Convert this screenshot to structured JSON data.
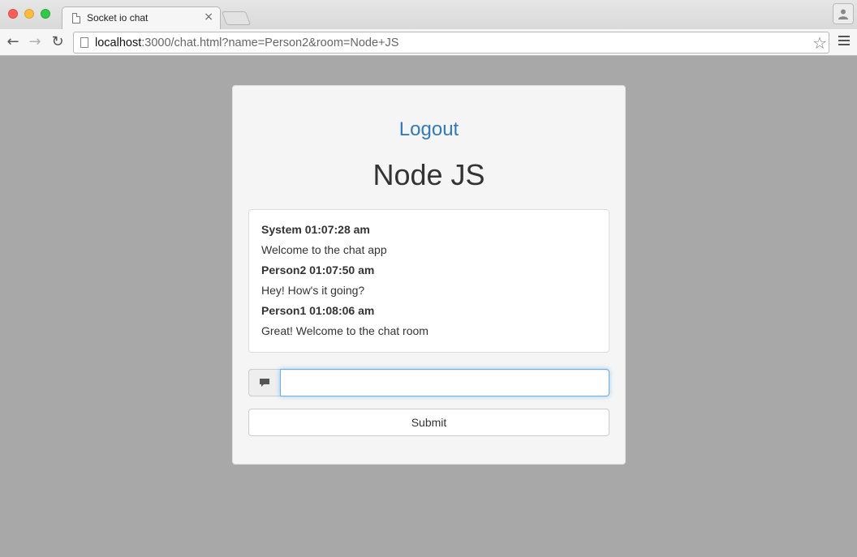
{
  "browser": {
    "tab_title": "Socket io chat",
    "tab_close": "×",
    "url_host": "localhost",
    "url_rest": ":3000/chat.html?name=Person2&room=Node+JS",
    "icons": {
      "back": "back-arrow-icon",
      "forward": "forward-arrow-icon",
      "reload": "reload-icon",
      "bookmark": "star-icon",
      "menu": "hamburger-menu-icon",
      "profile": "person-icon"
    }
  },
  "page": {
    "logout_label": "Logout",
    "room_name": "Node JS",
    "messages": [
      {
        "meta": "System 01:07:28 am",
        "text": "Welcome to the chat app"
      },
      {
        "meta": "Person2 01:07:50 am",
        "text": "Hey! How's it going?"
      },
      {
        "meta": "Person1 01:08:06 am",
        "text": "Great! Welcome to the chat room"
      }
    ],
    "message_input": {
      "value": "",
      "placeholder": ""
    },
    "input_icon": "comment-icon",
    "submit_label": "Submit"
  },
  "colors": {
    "page_background": "#a8a8a8",
    "link": "#337ab7",
    "input_focus": "#66afe9"
  }
}
